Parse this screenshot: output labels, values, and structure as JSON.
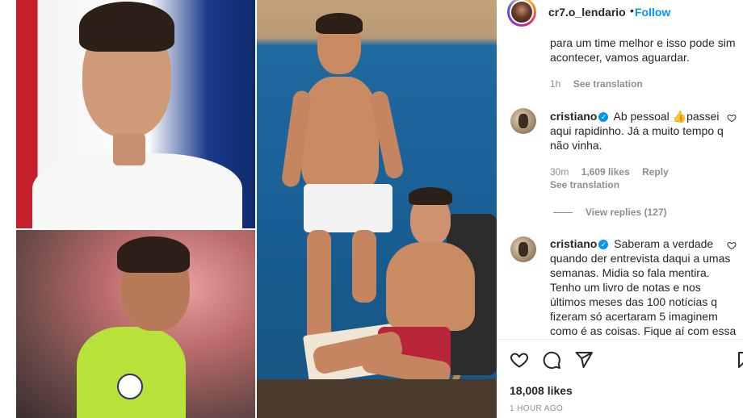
{
  "post": {
    "username": "cr7.o_lendario",
    "separator": "•",
    "follow_label": "Follow"
  },
  "comments": [
    {
      "text": "para um time melhor e isso pode sim acontecer, vamos aguardar.",
      "time": "1h",
      "see_translation": "See translation"
    },
    {
      "username": "cristiano",
      "text": "Ab pessoal 👍passei aqui rapidinho. Já a muito tempo q não vinha.",
      "time": "30m",
      "likes": "1,609 likes",
      "reply": "Reply",
      "see_translation": "See translation",
      "view_replies": "View replies (127)"
    },
    {
      "username": "cristiano",
      "text": "Saberam a verdade quando der entrevista daqui a umas semanas. Midia so fala mentira. Tenho um livro de notas e nos últimos meses das 100 notícias q fizeram só acertaram 5 imaginem como é as coisas. Fique aí com essa"
    }
  ],
  "footer": {
    "likes": "18,008 likes",
    "time_ago": "1 HOUR AGO"
  },
  "icons": {
    "verified": "verified-badge-icon",
    "like": "heart-icon",
    "comment": "comment-icon",
    "share": "paper-plane-icon",
    "save": "bookmark-icon"
  },
  "colors": {
    "link": "#0095f6",
    "text": "#262626",
    "muted": "#8e8e8e"
  }
}
